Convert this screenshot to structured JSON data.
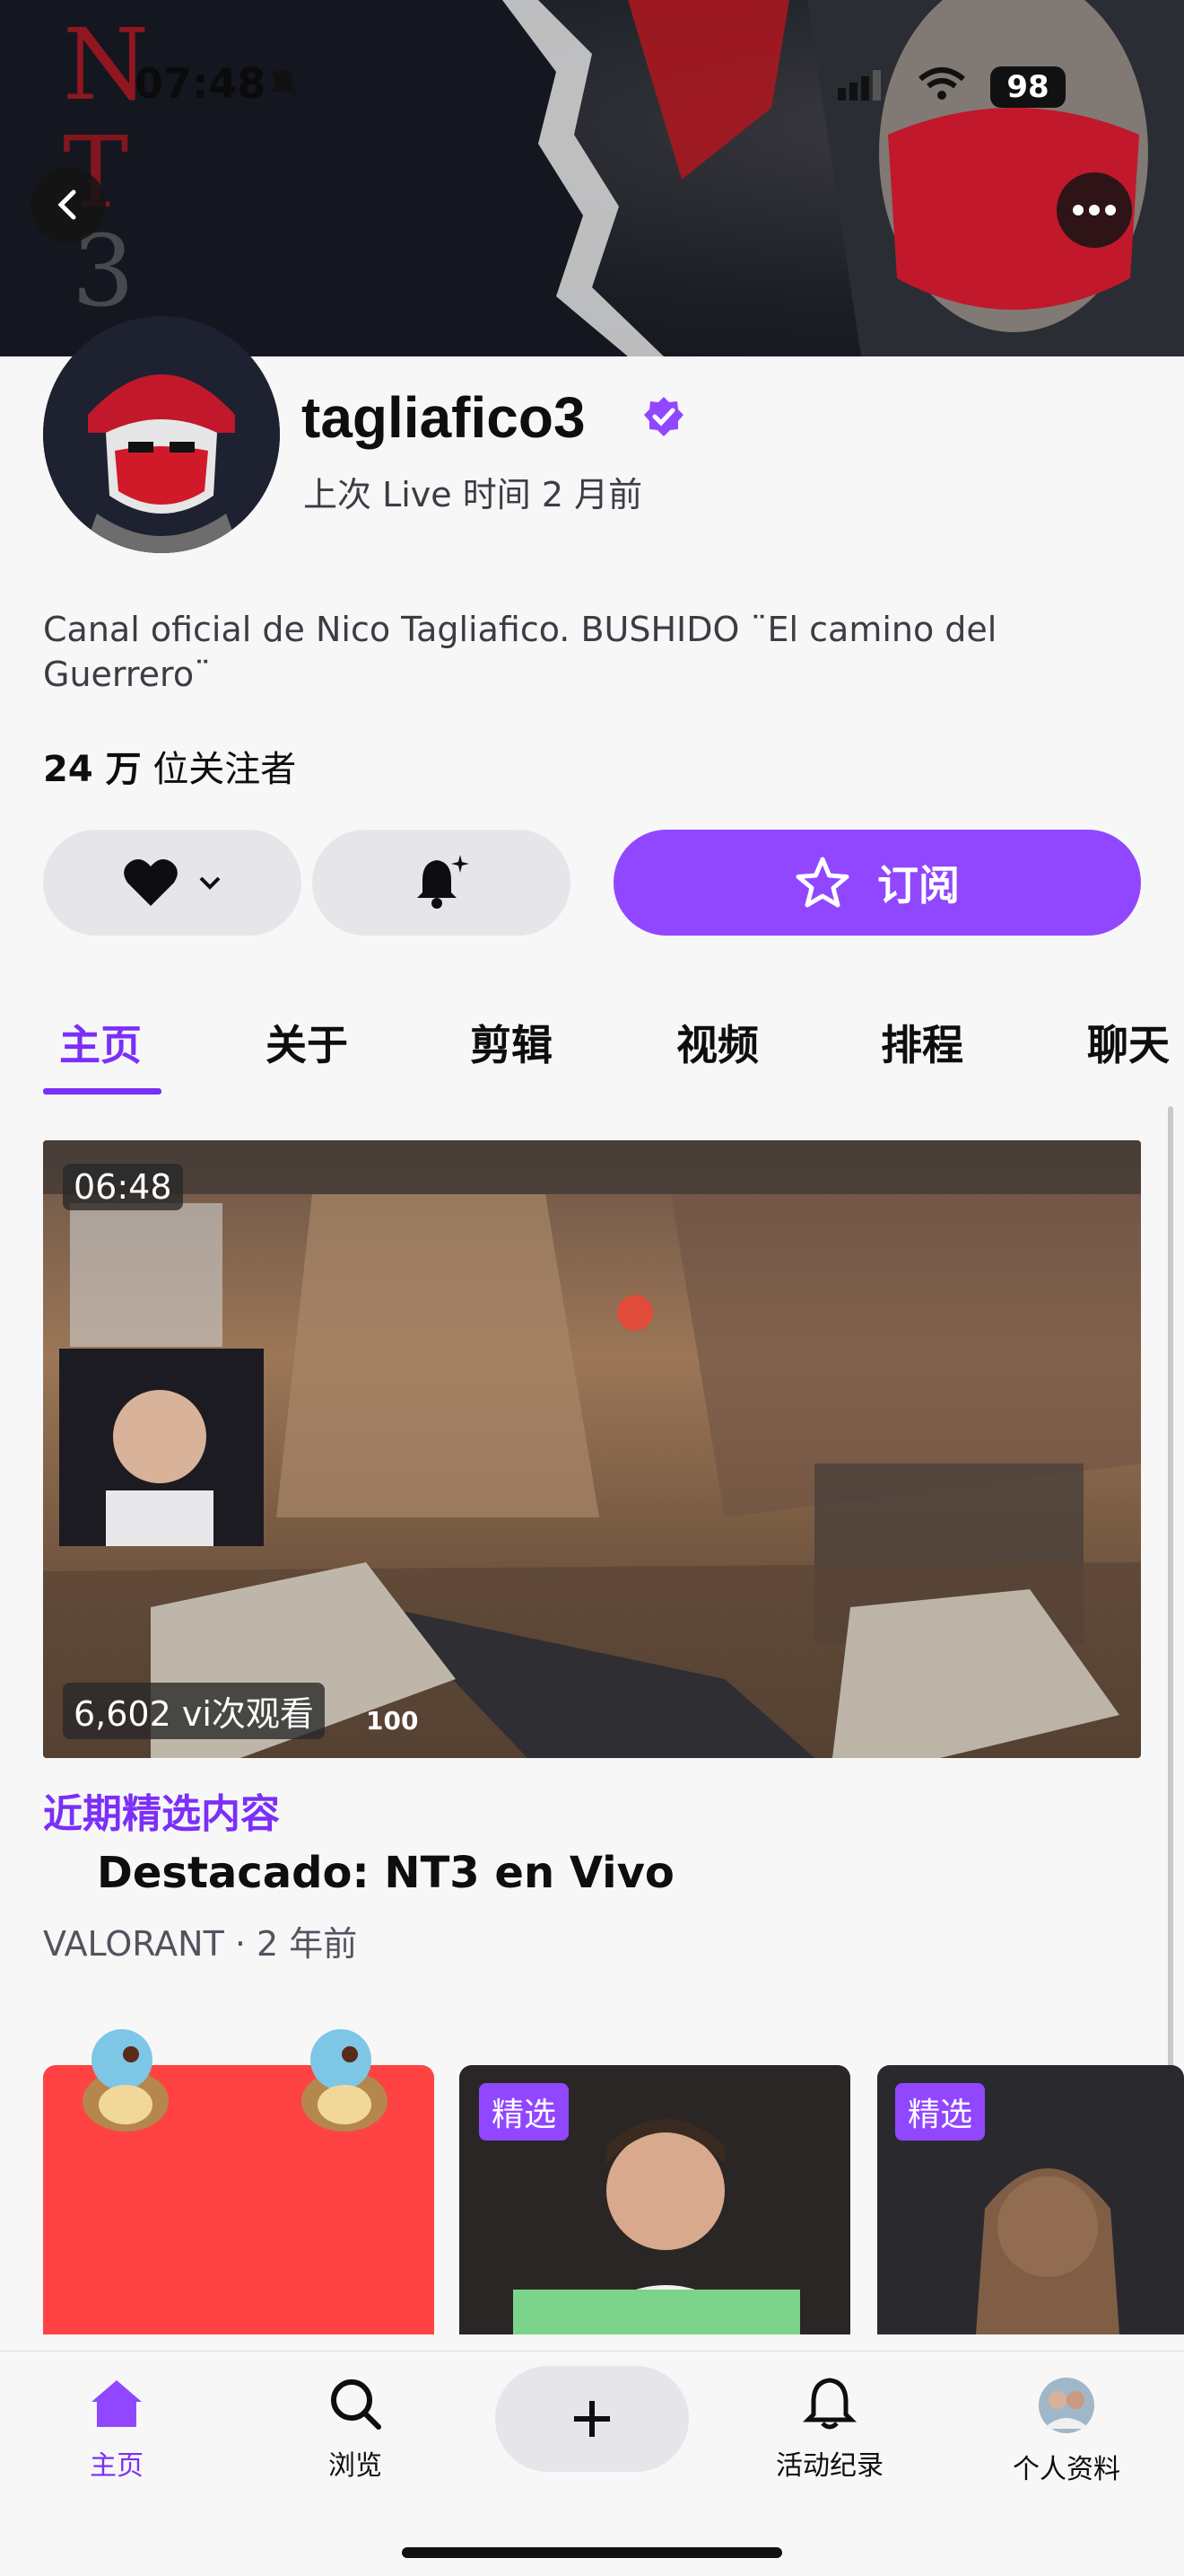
{
  "status_bar": {
    "time": "07:48",
    "battery": "98"
  },
  "channel": {
    "name": "tagliafico3",
    "last_live": "上次 Live 时间 2 月前",
    "description": "Canal oficial de Nico Tagliafico. BUSHIDO ¨El camino del Guerrero¨",
    "followers": "24 万",
    "followers_suffix": "位关注者"
  },
  "actions": {
    "subscribe_label": "订阅"
  },
  "tabs": [
    {
      "label": "主页",
      "active": true
    },
    {
      "label": "关于"
    },
    {
      "label": "剪辑"
    },
    {
      "label": "视频"
    },
    {
      "label": "排程"
    },
    {
      "label": "聊天"
    }
  ],
  "featured": {
    "duration": "06:48",
    "views": "6,602 vi次观看",
    "section_label": "近期精选内容",
    "title": "Destacado: NT3 en Vivo",
    "meta": "VALORANT · 2 年前",
    "hud_health": "100"
  },
  "cards": [
    {
      "badge": ""
    },
    {
      "badge": "精选"
    },
    {
      "badge": "精选"
    }
  ],
  "bottom_nav": [
    {
      "label": "主页",
      "icon": "home-icon",
      "active": true
    },
    {
      "label": "浏览",
      "icon": "search-icon"
    },
    {
      "label": "",
      "icon": "plus-icon"
    },
    {
      "label": "活动纪录",
      "icon": "bell-icon"
    },
    {
      "label": "个人资料",
      "icon": "avatar"
    }
  ],
  "colors": {
    "accent": "#9147ff",
    "accent_text": "#7b2ff7",
    "red_card": "#ff4343"
  }
}
